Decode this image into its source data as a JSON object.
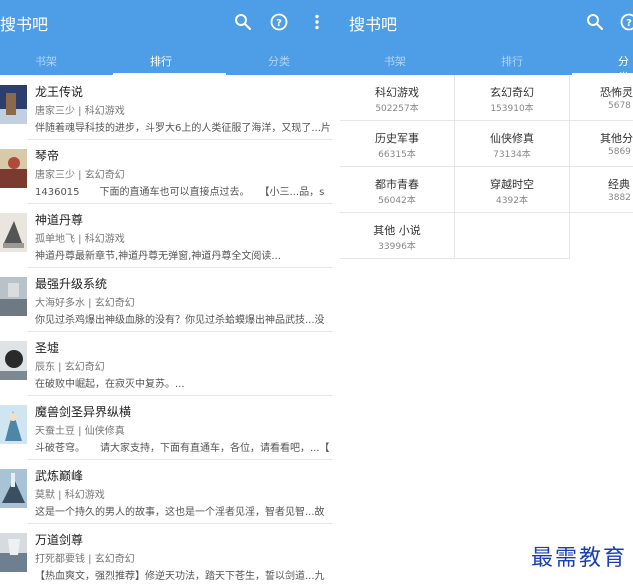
{
  "left": {
    "app_title": "搜书吧",
    "tabs": [
      "书架",
      "排行",
      "分类"
    ],
    "books": [
      {
        "title": "龙王传说",
        "meta": "唐家三少 | 科幻游戏",
        "desc": "伴随着魂导科技的进步，斗罗大6上的人类征服了海洋，又现了...片"
      },
      {
        "title": "琴帝",
        "meta": "唐家三少 | 玄幻奇幻",
        "desc": "1436015　　下面的直通车也可以直接点过去。　　【小三...品，s"
      },
      {
        "title": "神道丹尊",
        "meta": "孤单地飞 | 科幻游戏",
        "desc": "神道丹尊最新章节,神道丹尊无弹窗,神道丹尊全文阅读..."
      },
      {
        "title": "最强升级系统",
        "meta": "大海好多水 | 玄幻奇幻",
        "desc": "你见过杀鸡爆出神级血脉的没有？你见过杀蛤蟆爆出神品武技...没"
      },
      {
        "title": "圣墟",
        "meta": "辰东 | 玄幻奇幻",
        "desc": "在破败中崛起，在寂灭中复苏。..."
      },
      {
        "title": "魔兽剑圣异界纵横",
        "meta": "天蚕土豆 | 仙侠修真",
        "desc": "斗破苍穹。　　请大家支持，下面有直通车，各位，请看看吧，...【"
      },
      {
        "title": "武炼巅峰",
        "meta": "莫默 | 科幻游戏",
        "desc": "这是一个持久的男人的故事，这也是一个淫者见淫，智者见智...故"
      },
      {
        "title": "万道剑尊",
        "meta": "打死都要钱 | 玄幻奇幻",
        "desc": "【热血爽文，强烈推荐】修逆天功法，踏天下苍生，誓以剑道...九"
      }
    ]
  },
  "right": {
    "app_title": "搜书吧",
    "tabs": [
      "书架",
      "排行",
      "分类"
    ],
    "categories": [
      {
        "name": "科幻游戏",
        "count": "502257本"
      },
      {
        "name": "玄幻奇幻",
        "count": "153910本"
      },
      {
        "name": "恐怖灵",
        "count": "5678"
      },
      {
        "name": "历史军事",
        "count": "66315本"
      },
      {
        "name": "仙侠修真",
        "count": "73134本"
      },
      {
        "name": "其他分",
        "count": "5869"
      },
      {
        "name": "都市青春",
        "count": "56042本"
      },
      {
        "name": "穿越时空",
        "count": "4392本"
      },
      {
        "name": "经典",
        "count": "3882"
      },
      {
        "name": "其他 小说",
        "count": "33996本"
      }
    ]
  },
  "watermark": "最需教育",
  "colors": {
    "appbar": "#4d9ee6",
    "tab_inactive": "rgba(255,255,255,0.55)",
    "watermark": "#1a3fb0"
  },
  "icons": [
    "search-icon",
    "help-icon",
    "more-vert-icon"
  ]
}
